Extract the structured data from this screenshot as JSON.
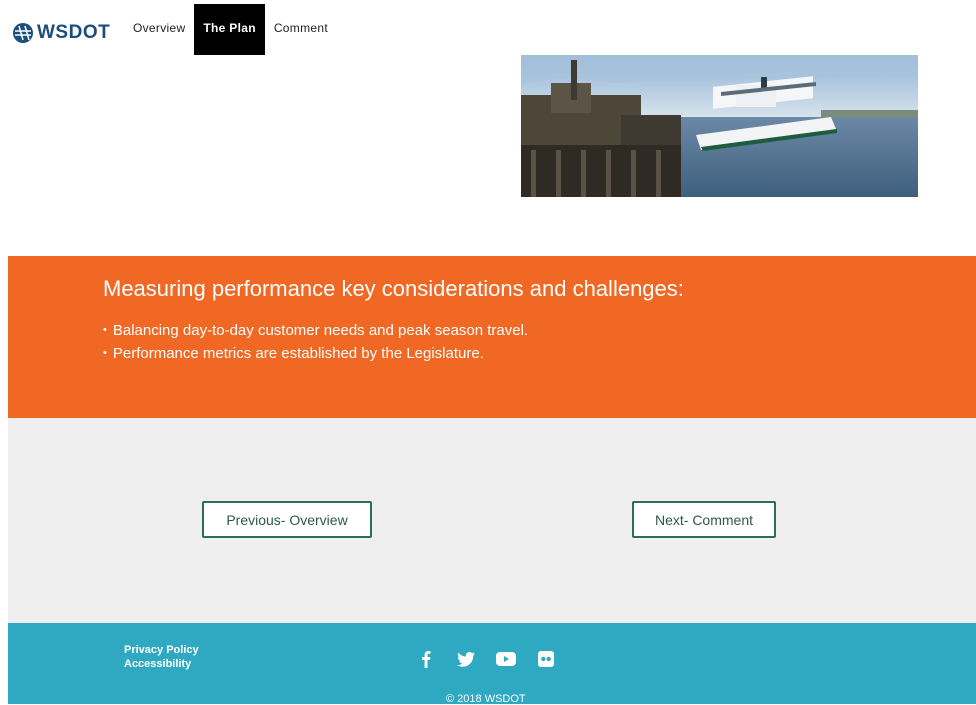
{
  "brand": {
    "name": "WSDOT",
    "color": "#1b4e7d"
  },
  "nav": {
    "items": [
      {
        "label": "Overview",
        "active": false
      },
      {
        "label": "The Plan",
        "active": true
      },
      {
        "label": "Comment",
        "active": false
      }
    ]
  },
  "hero": {
    "icon": "ferry-photo"
  },
  "considerations": {
    "heading": "Measuring performance key considerations and challenges:",
    "bullets": [
      "Balancing day-to-day customer needs and peak season travel.",
      "Performance metrics are established by the Legislature."
    ],
    "bullet_glyph": "•",
    "background": "#f06824"
  },
  "pager": {
    "previous_label": "Previous- Overview",
    "next_label": "Next- Comment",
    "border_color": "#2d6e57"
  },
  "footer": {
    "links": [
      "Privacy Policy",
      "Accessibility"
    ],
    "social_icons": [
      "facebook-icon",
      "twitter-icon",
      "youtube-icon",
      "flickr-icon"
    ],
    "copyright": "© 2018 WSDOT",
    "background": "#2fa8c1"
  }
}
